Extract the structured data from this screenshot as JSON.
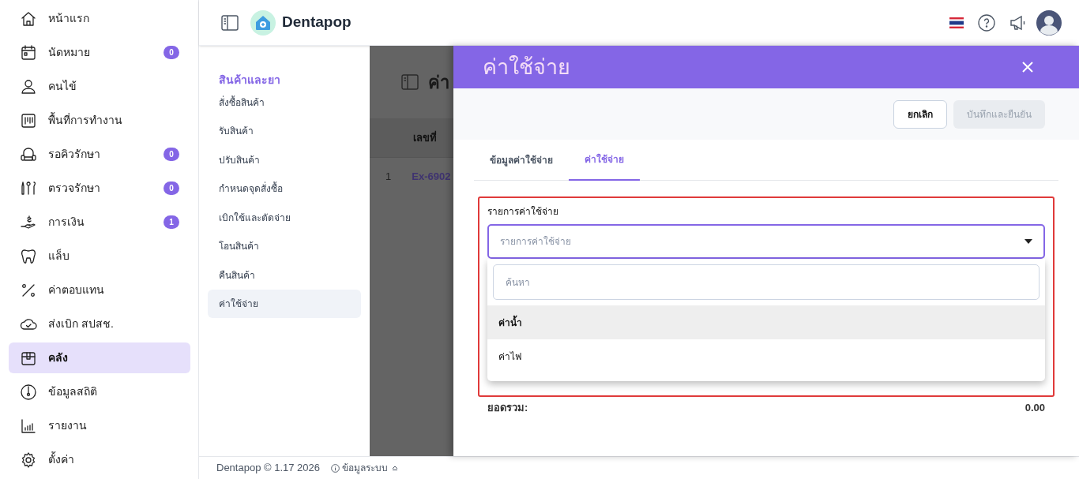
{
  "sidebar": {
    "items": [
      {
        "label": "หน้าแรก",
        "selected": false
      },
      {
        "label": "นัดหมาย",
        "badge": "0",
        "selected": false
      },
      {
        "label": "คนไข้",
        "selected": false
      },
      {
        "label": "พื้นที่การทำงาน",
        "selected": false
      },
      {
        "label": "รอคิวรักษา",
        "badge": "0",
        "selected": false
      },
      {
        "label": "ตรวจรักษา",
        "badge": "0",
        "selected": false
      },
      {
        "label": "การเงิน",
        "badge": "1",
        "selected": false
      },
      {
        "label": "แล็บ",
        "selected": false
      },
      {
        "label": "ค่าตอบแทน",
        "selected": false
      },
      {
        "label": "ส่งเบิก สปสช.",
        "selected": false
      },
      {
        "label": "คลัง",
        "selected": true
      },
      {
        "label": "ข้อมูลสถิติ",
        "selected": false
      },
      {
        "label": "รายงาน",
        "selected": false
      },
      {
        "label": "ตั้งค่า",
        "selected": false
      }
    ]
  },
  "header": {
    "brand": "Dentapop"
  },
  "submenu": {
    "title": "สินค้าและยา",
    "items": [
      {
        "label": "สั่งซื้อสินค้า",
        "selected": false
      },
      {
        "label": "รับสินค้า",
        "selected": false
      },
      {
        "label": "ปรับสินค้า",
        "selected": false
      },
      {
        "label": "กำหนดจุดสั่งซื้อ",
        "selected": false
      },
      {
        "label": "เบิกใช้และตัดจ่าย",
        "selected": false
      },
      {
        "label": "โอนสินค้า",
        "selected": false
      },
      {
        "label": "คืนสินค้า",
        "selected": false
      },
      {
        "label": "ค่าใช้จ่าย",
        "selected": true
      }
    ]
  },
  "background_page": {
    "title": "ค่า",
    "column_header": "เลขที่",
    "row": {
      "index": "1",
      "number": "Ex-6902"
    }
  },
  "drawer": {
    "title": "ค่าใช้จ่าย",
    "buttons": [
      {
        "label": "ยกเลิก",
        "disabled": false
      },
      {
        "label": "บันทึกและยืนยัน",
        "disabled": true
      }
    ],
    "tabs": [
      {
        "label": "ข้อมูลค่าใช้จ่าย",
        "selected": false
      },
      {
        "label": "ค่าใช้จ่าย",
        "selected": true
      }
    ],
    "field": {
      "label": "รายการค่าใช้จ่าย",
      "placeholder": "รายการค่าใช้จ่าย"
    },
    "dropdown": {
      "search_placeholder": "ค้นหา",
      "options": [
        {
          "label": "ค่าน้ำ",
          "selected": true
        },
        {
          "label": "ค่าไฟ",
          "selected": false
        }
      ]
    },
    "total": {
      "label": "ยอดรวม:",
      "value": "0.00"
    }
  },
  "footer": {
    "version": "Dentapop © 1.17 2026",
    "info": "ข้อมูลระบบ"
  }
}
